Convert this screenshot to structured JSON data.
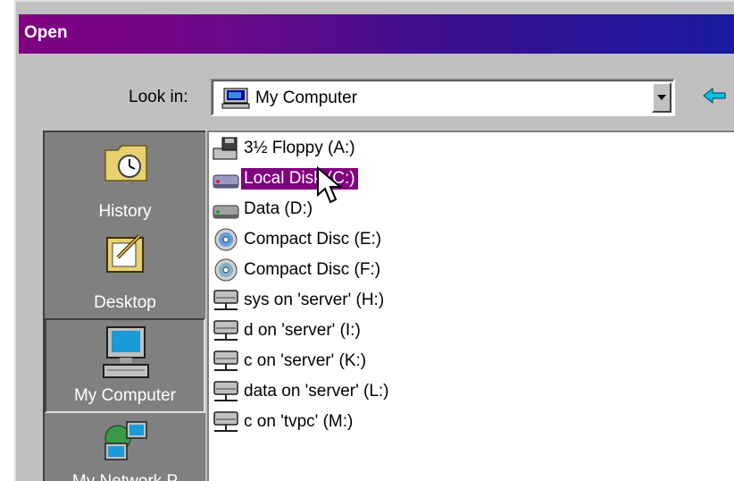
{
  "window": {
    "title": "Open"
  },
  "lookin": {
    "label": "Look in:",
    "value": "My Computer",
    "icon": "my-computer-icon"
  },
  "places": [
    {
      "label": "History",
      "icon": "history-icon",
      "selected": false
    },
    {
      "label": "Desktop",
      "icon": "desktop-icon",
      "selected": false
    },
    {
      "label": "My Computer",
      "icon": "my-computer-icon",
      "selected": true
    },
    {
      "label": "My Network P",
      "icon": "network-places-icon",
      "selected": false
    }
  ],
  "files": [
    {
      "label": "3½ Floppy (A:)",
      "icon": "floppy-drive-icon",
      "selected": false
    },
    {
      "label": "Local Disk (C:)",
      "icon": "hard-disk-icon",
      "selected": true
    },
    {
      "label": "Data (D:)",
      "icon": "hard-disk-icon",
      "selected": false
    },
    {
      "label": "Compact Disc (E:)",
      "icon": "cd-drive-icon",
      "selected": false
    },
    {
      "label": "Compact Disc (F:)",
      "icon": "cd-drive-icon",
      "selected": false
    },
    {
      "label": "sys on 'server' (H:)",
      "icon": "network-drive-icon",
      "selected": false
    },
    {
      "label": "d on 'server' (I:)",
      "icon": "network-drive-icon",
      "selected": false
    },
    {
      "label": "c on 'server' (K:)",
      "icon": "network-drive-icon",
      "selected": false
    },
    {
      "label": "data on 'server' (L:)",
      "icon": "network-drive-icon",
      "selected": false
    },
    {
      "label": "c on 'tvpc' (M:)",
      "icon": "network-drive-icon",
      "selected": false
    }
  ],
  "colors": {
    "title_gradient_start": "#800080",
    "title_gradient_end": "#1a1aa0",
    "selection": "#800080",
    "dialog_face": "#c0c0c0",
    "places_bar": "#808080"
  }
}
